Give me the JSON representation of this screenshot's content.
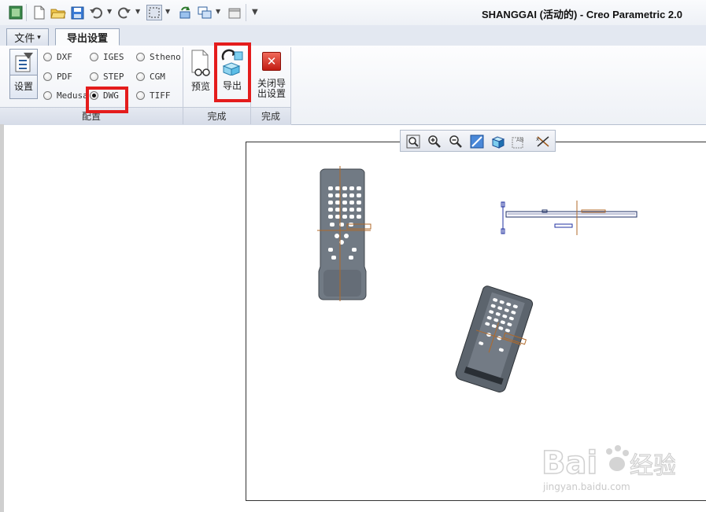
{
  "window": {
    "title": "SHANGGAI (活动的) - Creo Parametric 2.0"
  },
  "quick_access": {
    "icons": [
      "creo-app-icon",
      "new-file-icon",
      "open-folder-icon",
      "save-icon",
      "undo-icon",
      "redo-icon",
      "select-box-icon",
      "regenerate-icon",
      "windows-icon",
      "close-window-icon",
      "customize-toolbar-icon"
    ]
  },
  "tabs": [
    {
      "label": "文件",
      "caret": "▾"
    },
    {
      "label": "导出设置"
    }
  ],
  "ribbon": {
    "setup": {
      "label": "设置"
    },
    "formats": [
      {
        "label": "DXF",
        "selected": false
      },
      {
        "label": "PDF",
        "selected": false
      },
      {
        "label": "Medusa",
        "selected": false
      },
      {
        "label": "IGES",
        "selected": false
      },
      {
        "label": "STEP",
        "selected": false
      },
      {
        "label": "DWG",
        "selected": true
      },
      {
        "label": "Stheno",
        "selected": false
      },
      {
        "label": "CGM",
        "selected": false
      },
      {
        "label": "TIFF",
        "selected": false
      }
    ],
    "preview": {
      "label": "预览"
    },
    "export": {
      "label": "导出"
    },
    "close": {
      "label_line1": "关闭导",
      "label_line2": "出设置"
    },
    "groups": {
      "config": "配置",
      "finish1": "完成",
      "finish2": "完成"
    }
  },
  "view_toolbar": {
    "icons": [
      "refit-icon",
      "zoom-in-icon",
      "zoom-out-icon",
      "repaint-icon",
      "shading-display-icon",
      "annotation-display-icon",
      "datum-display-icon"
    ]
  },
  "watermark": {
    "brand": "Bai",
    "brand2": "经验",
    "url": "jingyan.baidu.com"
  },
  "colors": {
    "highlight": "#e41c1c",
    "model": "#6f7781",
    "axis": "#b06a2a"
  }
}
